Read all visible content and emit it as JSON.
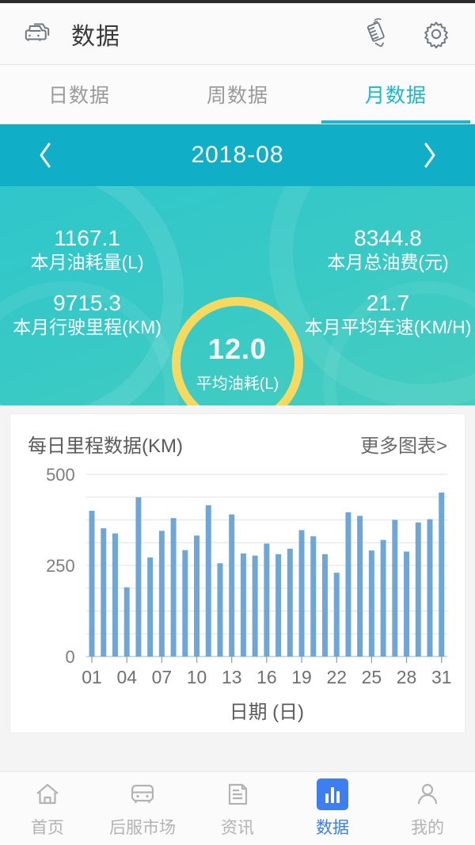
{
  "header": {
    "title": "数据",
    "car_switch_icon": "car-switch-icon",
    "remote_icon": "hand-holding-phone-icon",
    "settings_icon": "gear-icon"
  },
  "tabs": [
    {
      "label": "日数据",
      "active": false
    },
    {
      "label": "周数据",
      "active": false
    },
    {
      "label": "月数据",
      "active": true
    }
  ],
  "summary": {
    "prev_icon": "chevron-left-icon",
    "next_icon": "chevron-right-icon",
    "period": "2018-08",
    "center": {
      "value": "12.0",
      "label": "平均油耗(L)",
      "ring_color": "#f6d95e"
    },
    "top_left": {
      "value": "1167.1",
      "label": "本月油耗量(L)"
    },
    "bottom_left": {
      "value": "9715.3",
      "label": "本月行驶里程(KM)"
    },
    "top_right": {
      "value": "8344.8",
      "label": "本月总油费(元)"
    },
    "bottom_right": {
      "value": "21.7",
      "label": "本月平均车速(KM/H)"
    },
    "panel_color": "#37c9c6",
    "datebar_color": "#10afc7"
  },
  "card": {
    "title": "每日里程数据(KM)",
    "more_label": "更多图表>"
  },
  "chart_data": {
    "type": "bar",
    "title": "每日里程数据(KM)",
    "xlabel": "日期 (日)",
    "ylabel": "",
    "ylim": [
      0,
      500
    ],
    "yticks": [
      0,
      250,
      500
    ],
    "ytick_labels": [
      "0",
      "250",
      "500"
    ],
    "gridlines": [
      62.5,
      125,
      187.5,
      250,
      312.5,
      375,
      437.5,
      500
    ],
    "grid": true,
    "legend": "none",
    "bar_color": "#6ea6d8",
    "categories": [
      "01",
      "02",
      "03",
      "04",
      "05",
      "06",
      "07",
      "08",
      "09",
      "10",
      "11",
      "12",
      "13",
      "14",
      "15",
      "16",
      "17",
      "18",
      "19",
      "20",
      "21",
      "22",
      "23",
      "24",
      "25",
      "26",
      "27",
      "28",
      "29",
      "30",
      "31"
    ],
    "xtick_labels": [
      "01",
      "04",
      "07",
      "10",
      "13",
      "16",
      "19",
      "22",
      "25",
      "28",
      "31"
    ],
    "values": [
      400,
      352,
      338,
      190,
      437,
      272,
      345,
      380,
      292,
      332,
      415,
      256,
      390,
      283,
      277,
      310,
      281,
      296,
      347,
      330,
      281,
      230,
      396,
      386,
      291,
      320,
      375,
      288,
      368,
      377,
      450
    ]
  },
  "bottom_nav": [
    {
      "label": "首页",
      "icon": "home-icon",
      "active": false
    },
    {
      "label": "后服市场",
      "icon": "van-icon",
      "active": false
    },
    {
      "label": "资讯",
      "icon": "news-icon",
      "active": false
    },
    {
      "label": "数据",
      "icon": "bar-chart-icon",
      "active": true
    },
    {
      "label": "我的",
      "icon": "person-icon",
      "active": false
    }
  ]
}
